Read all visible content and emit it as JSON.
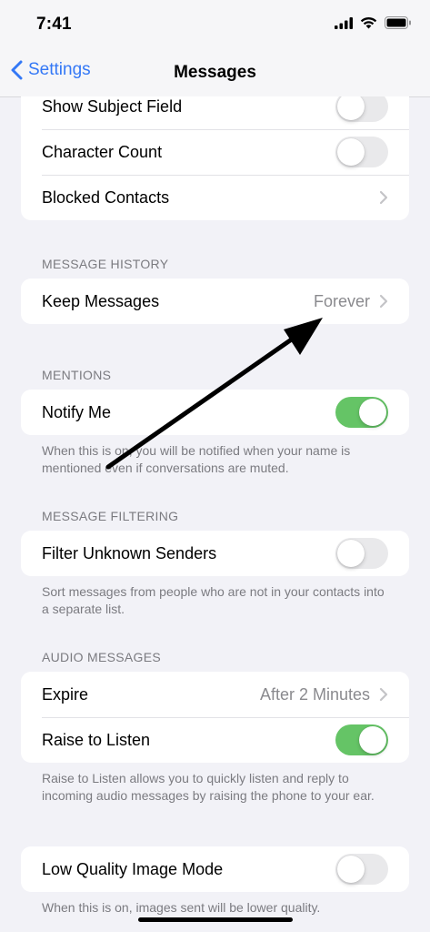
{
  "status": {
    "time": "7:41"
  },
  "nav": {
    "back_label": "Settings",
    "title": "Messages"
  },
  "group1": {
    "subject_label": "Show Subject Field",
    "charcount_label": "Character Count",
    "blocked_label": "Blocked Contacts"
  },
  "history": {
    "header": "MESSAGE HISTORY",
    "keep_label": "Keep Messages",
    "keep_value": "Forever"
  },
  "mentions": {
    "header": "MENTIONS",
    "notify_label": "Notify Me",
    "footer": "When this is on, you will be notified when your name is mentioned even if conversations are muted."
  },
  "filtering": {
    "header": "MESSAGE FILTERING",
    "filter_label": "Filter Unknown Senders",
    "footer": "Sort messages from people who are not in your contacts into a separate list."
  },
  "audio": {
    "header": "AUDIO MESSAGES",
    "expire_label": "Expire",
    "expire_value": "After 2 Minutes",
    "raise_label": "Raise to Listen",
    "footer": "Raise to Listen allows you to quickly listen and reply to incoming audio messages by raising the phone to your ear."
  },
  "lowquality": {
    "label": "Low Quality Image Mode",
    "footer": "When this is on, images sent will be lower quality."
  },
  "toggles": {
    "show_subject": false,
    "character_count": false,
    "notify_me": true,
    "filter_unknown": false,
    "raise_to_listen": true,
    "low_quality": false
  },
  "colors": {
    "accent": "#3478f6",
    "toggle_on": "#65c466",
    "toggle_off": "#e9e9eb"
  }
}
